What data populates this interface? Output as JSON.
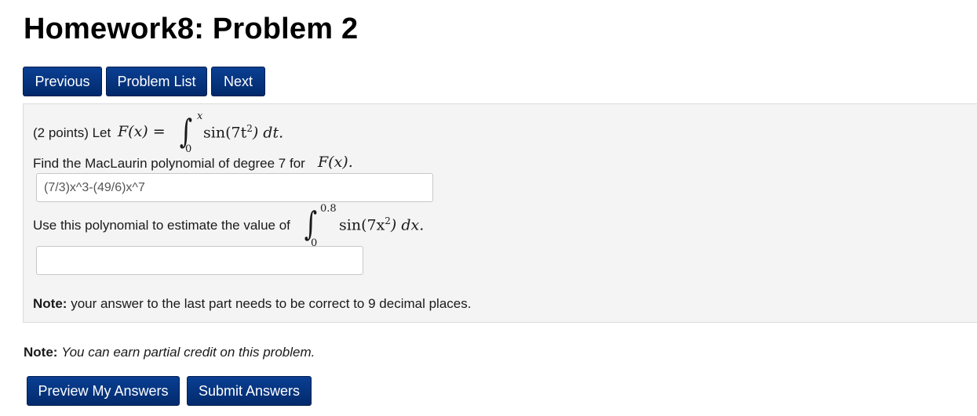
{
  "header": {
    "title": "Homework8: Problem 2"
  },
  "nav": {
    "previous_label": "Previous",
    "problem_list_label": "Problem List",
    "next_label": "Next"
  },
  "problem": {
    "points_text": "(2 points) Let",
    "function_lhs": "F(x) =",
    "integral1_upper": "x",
    "integral1_lower": "0",
    "integrand1": "sin(7t",
    "integrand1_exp": "2",
    "integrand1_tail": ") dt.",
    "find_text": "Find the MacLaurin polynomial of degree 7 for",
    "find_math": "F(x).",
    "answer1_value": "(7/3)x^3-(49/6)x^7",
    "estimate_text": "Use this polynomial to estimate the value of",
    "integral2_upper": "0.8",
    "integral2_lower": "0",
    "integrand2": "sin(7x",
    "integrand2_exp": "2",
    "integrand2_tail": ") dx.",
    "answer2_value": "",
    "note_label": "Note:",
    "note_text": "your answer to the last part needs to be correct to 9 decimal places."
  },
  "footer": {
    "note_label": "Note:",
    "note_text": "You can earn partial credit on this problem.",
    "preview_label": "Preview My Answers",
    "submit_label": "Submit Answers"
  },
  "colors": {
    "button_bg": "#02337f",
    "panel_bg": "#f4f4f4"
  }
}
